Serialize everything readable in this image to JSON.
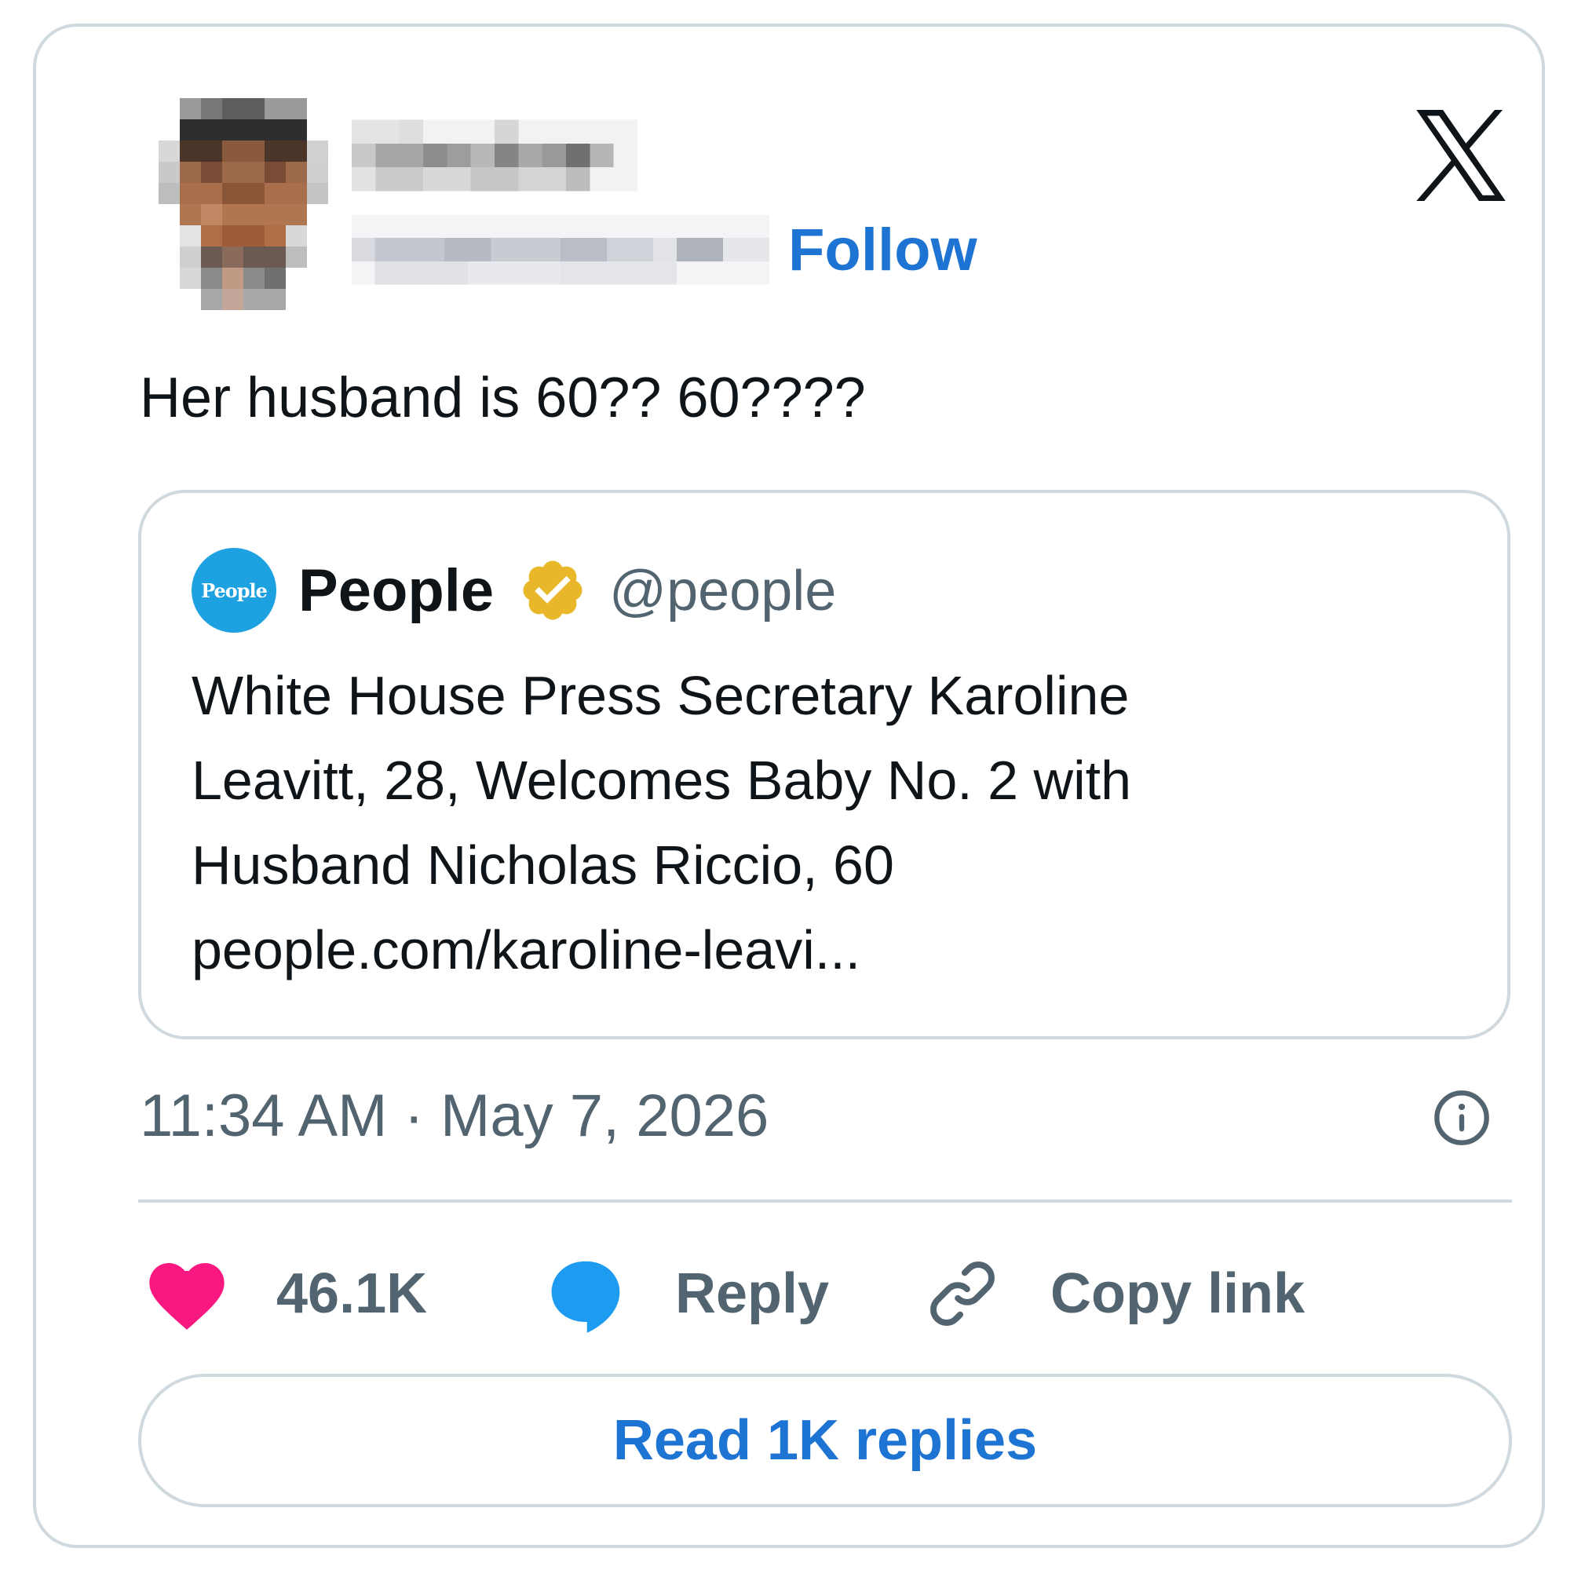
{
  "header": {
    "follow_label": "Follow",
    "x_logo_icon": "x-logo-icon",
    "avatar_icon": "pixelated-avatar-icon"
  },
  "tweet": {
    "text": "Her husband is 60?? 60????"
  },
  "quote": {
    "avatar_text": "People",
    "name": "People",
    "handle": "@people",
    "body_lines": [
      "White House Press Secretary Karoline",
      "Leavitt, 28, Welcomes Baby No. 2 with",
      "Husband Nicholas Riccio, 60",
      "people.com/karoline-leavi..."
    ],
    "verified_icon": "verified-badge-icon"
  },
  "meta": {
    "timestamp": "11:34 AM · May 7, 2026",
    "info_icon": "info-icon"
  },
  "actions": {
    "like_count": "46.1K",
    "reply_label": "Reply",
    "copy_label": "Copy link",
    "read_replies_label": "Read 1K replies"
  },
  "colors": {
    "accent_blue": "#1d74d3",
    "like_pink": "#f91880",
    "reply_blue": "#1d9bf0",
    "secondary_text": "#536471",
    "border": "#cfd9de",
    "verified_gold": "#e8b82a",
    "people_blue": "#1da1e0"
  }
}
